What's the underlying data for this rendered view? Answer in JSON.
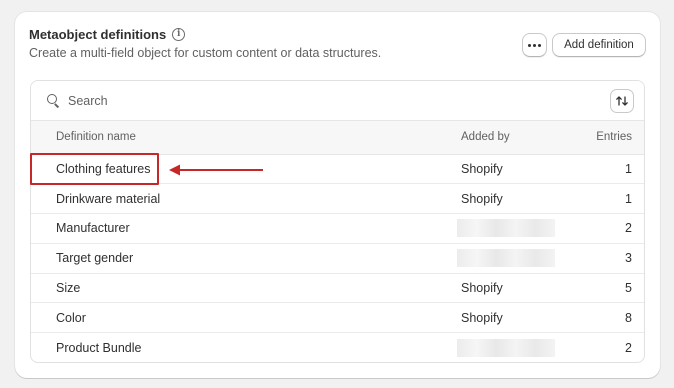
{
  "header": {
    "title": "Metaobject definitions",
    "info_glyph": "i",
    "subtitle": "Create a multi-field object for custom content or data structures.",
    "add_label": "Add definition"
  },
  "search": {
    "placeholder": "Search"
  },
  "table": {
    "columns": [
      "Definition name",
      "Added by",
      "Entries"
    ],
    "rows": [
      {
        "name": "Clothing features",
        "added_by": "Shopify",
        "entries": "1"
      },
      {
        "name": "Drinkware material",
        "added_by": "Shopify",
        "entries": "1"
      },
      {
        "name": "Manufacturer",
        "added_by": "",
        "entries": "2"
      },
      {
        "name": "Target gender",
        "added_by": "",
        "entries": "3"
      },
      {
        "name": "Size",
        "added_by": "Shopify",
        "entries": "5"
      },
      {
        "name": "Color",
        "added_by": "Shopify",
        "entries": "8"
      },
      {
        "name": "Product Bundle",
        "added_by": "",
        "entries": "2"
      }
    ]
  },
  "annotation": {
    "color": "#c62828"
  }
}
